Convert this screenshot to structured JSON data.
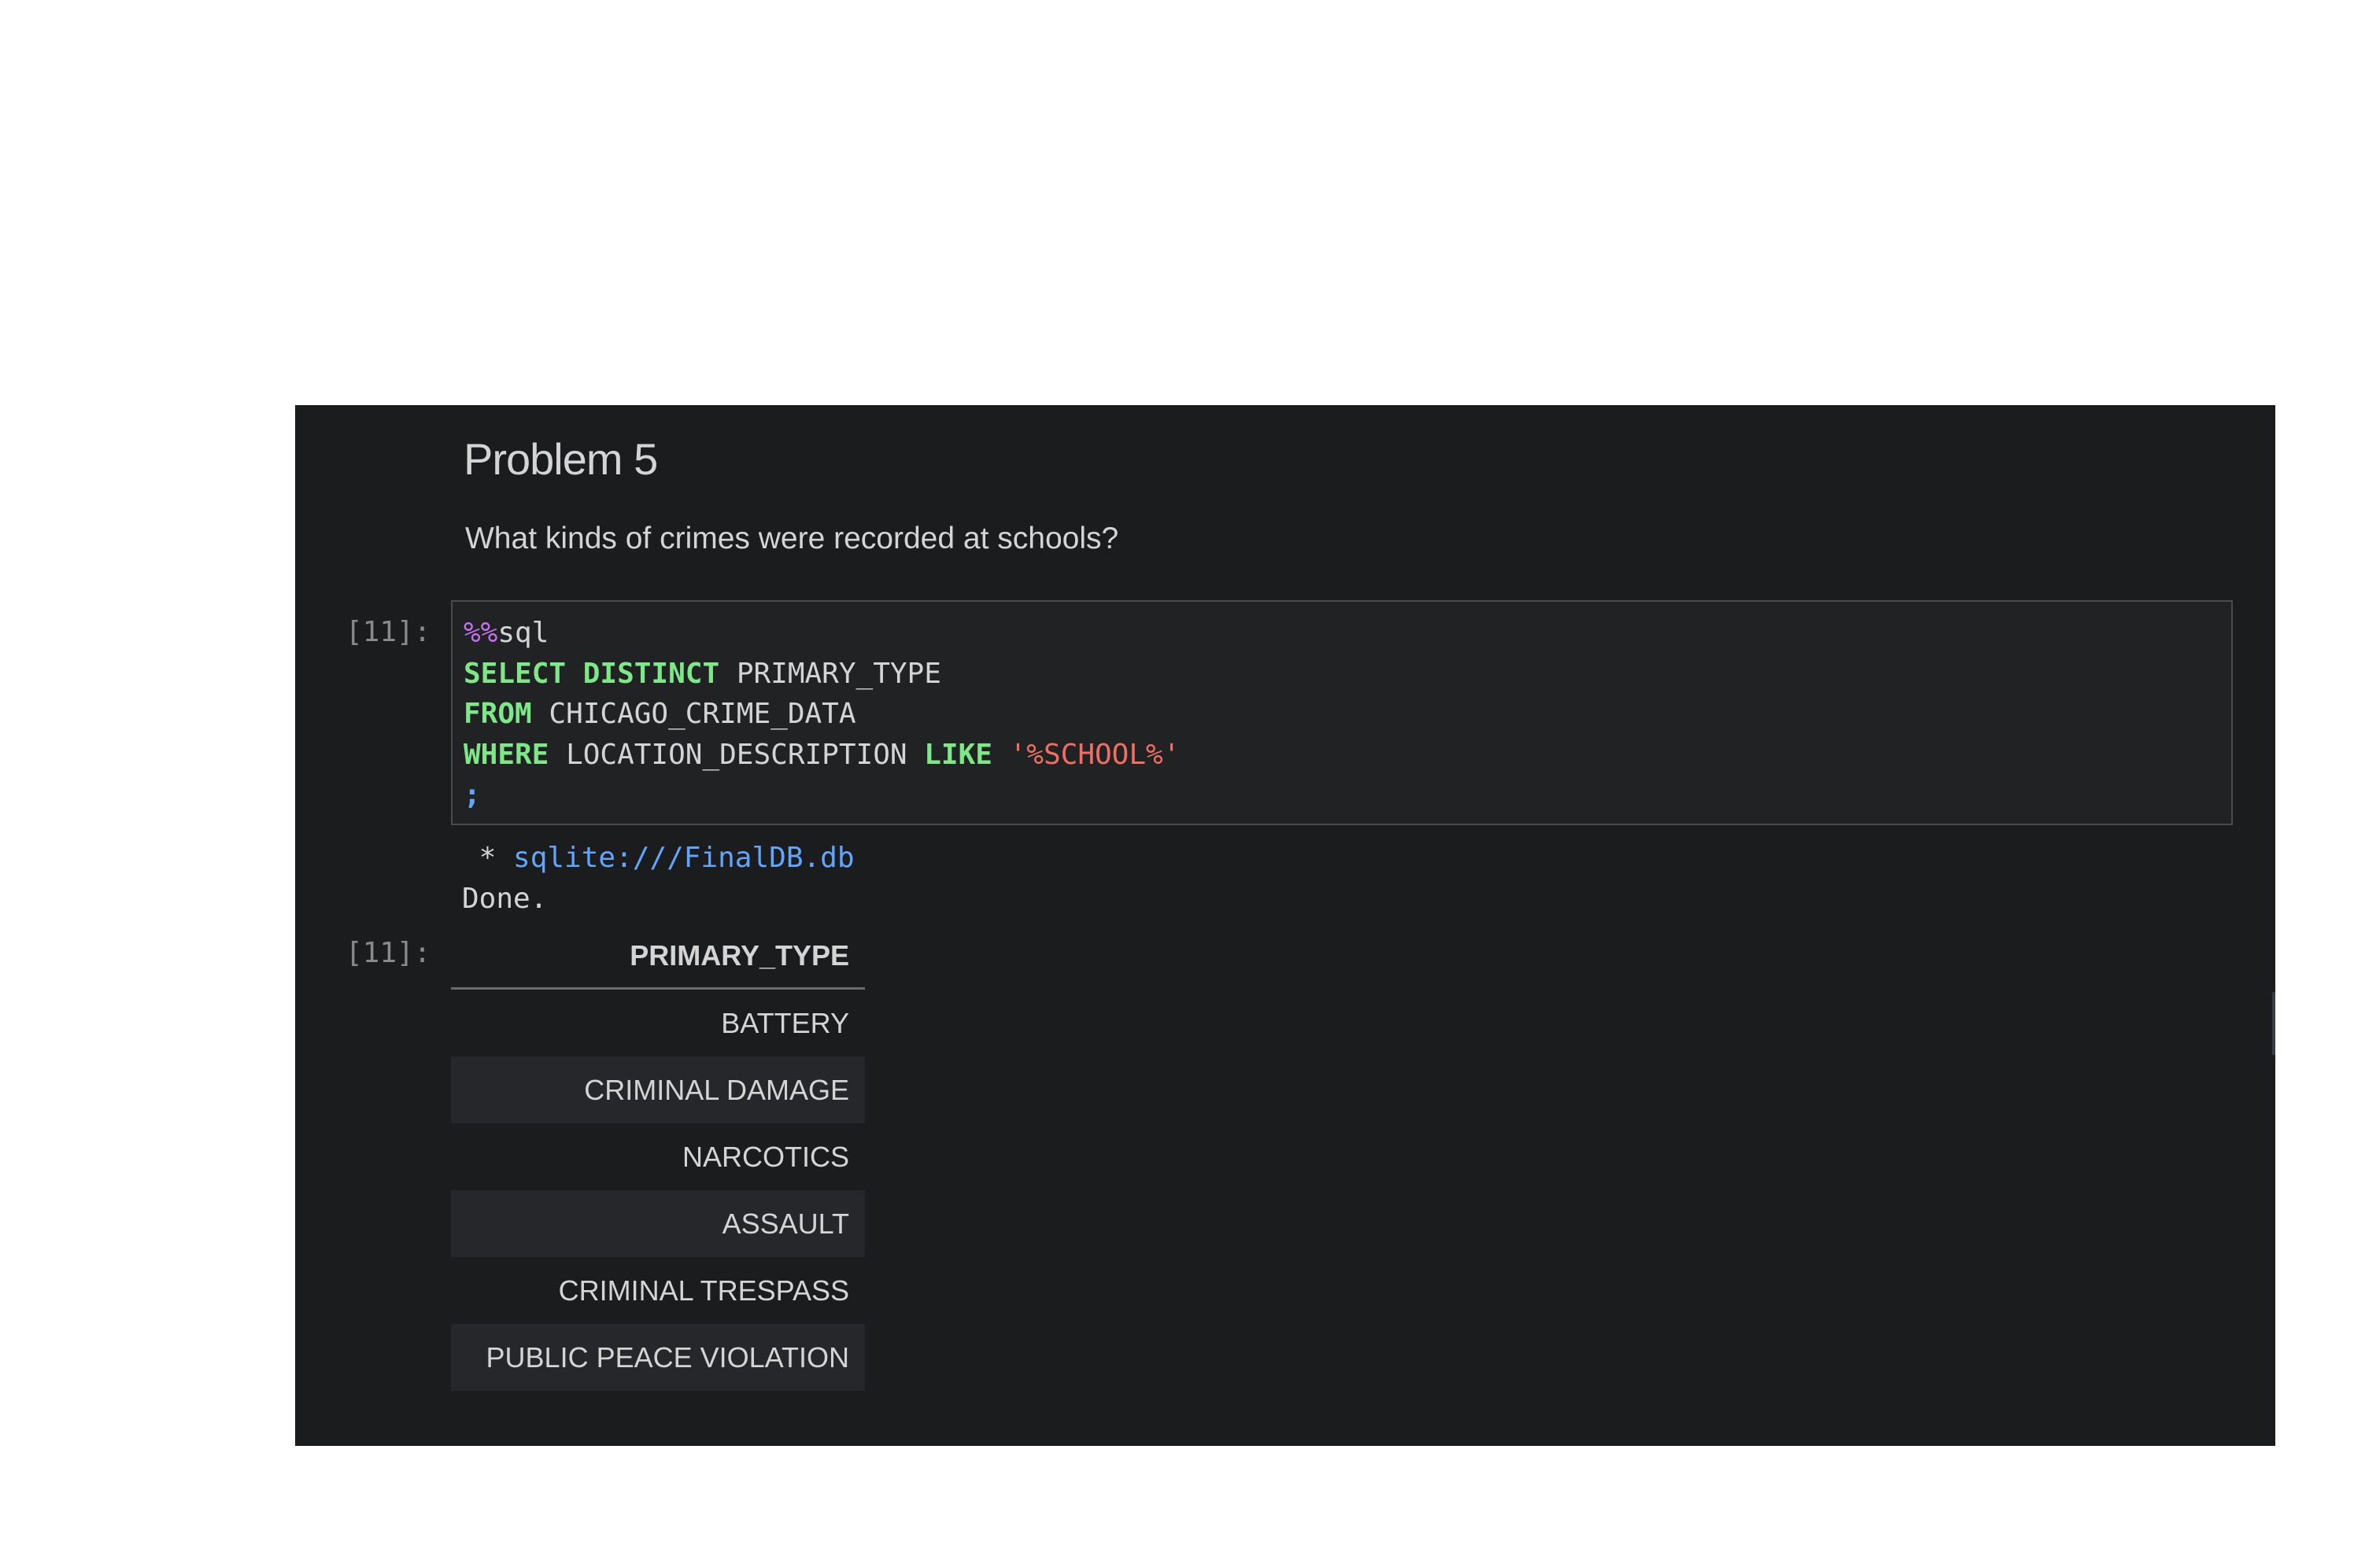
{
  "markdown": {
    "heading": "Problem 5",
    "question": "What kinds of crimes were recorded at schools?"
  },
  "input_cell": {
    "prompt": "[11]:",
    "code": {
      "magic_symbol": "%%",
      "magic_name": "sql",
      "kw_select": "SELECT",
      "kw_distinct": "DISTINCT",
      "select_column": "PRIMARY_TYPE",
      "kw_from": "FROM",
      "table_name": "CHICAGO_CRIME_DATA",
      "kw_where": "WHERE",
      "where_column": "LOCATION_DESCRIPTION",
      "kw_like": "LIKE",
      "like_pattern": "'%SCHOOL%'",
      "terminator": ";"
    }
  },
  "stream_output": {
    "connection_bullet": " * ",
    "connection_string": "sqlite:///FinalDB.db",
    "status": "Done."
  },
  "output_cell": {
    "prompt": "[11]:",
    "table": {
      "header": "PRIMARY_TYPE",
      "rows": [
        "BATTERY",
        "CRIMINAL DAMAGE",
        "NARCOTICS",
        "ASSAULT",
        "CRIMINAL TRESPASS",
        "PUBLIC PEACE VIOLATION"
      ]
    }
  },
  "theme": {
    "background": "#1b1c1e",
    "text": "#d4d4d4",
    "keyword": "#7ee787",
    "string": "#ef6f62",
    "magic": "#c471ed",
    "link": "#63a4ff"
  }
}
